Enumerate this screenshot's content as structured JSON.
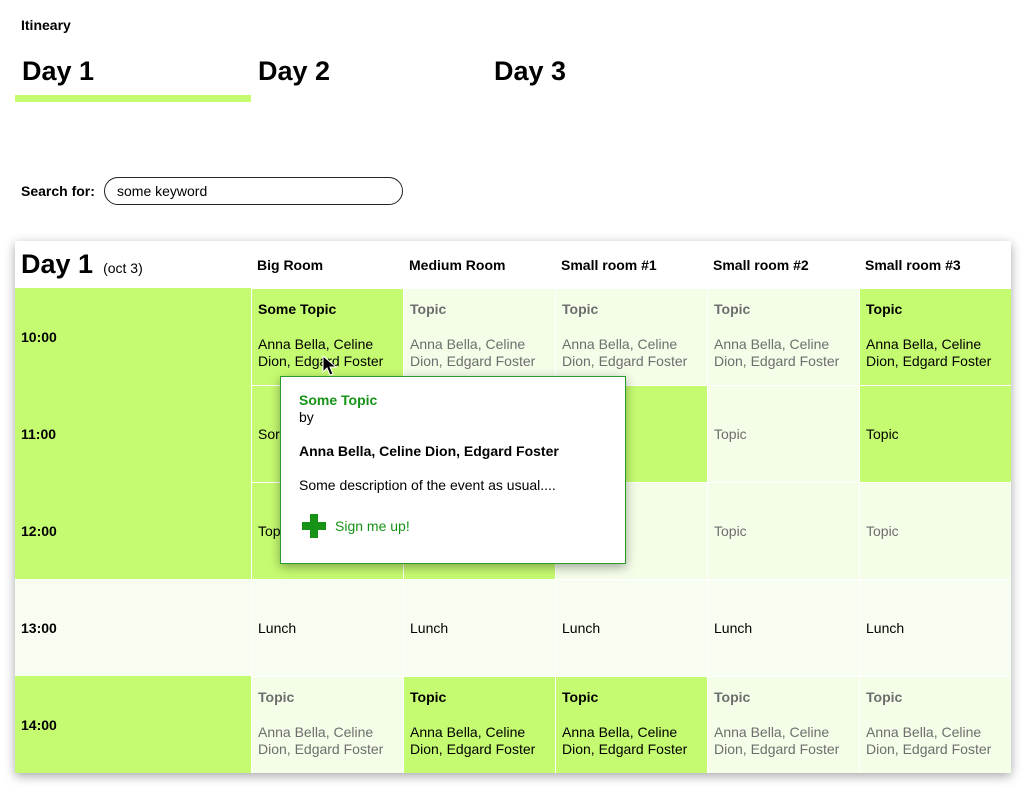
{
  "app": {
    "title": "Itineary"
  },
  "tabs": [
    {
      "label": "Day 1",
      "active": true
    },
    {
      "label": "Day 2",
      "active": false
    },
    {
      "label": "Day 3",
      "active": false
    }
  ],
  "search": {
    "label": "Search for:",
    "value": "some keyword"
  },
  "schedule": {
    "day_title": "Day 1",
    "day_date": "(oct 3)",
    "rooms": [
      "Big Room",
      "Medium Room",
      "Small room #1",
      "Small room #2",
      "Small room #3"
    ],
    "times": [
      "10:00",
      "11:00",
      "12:00",
      "13:00",
      "14:00"
    ],
    "sessions": {
      "r10": [
        {
          "title": "Some Topic",
          "speakers": "Anna Bella, Celine Dion, Edgard Foster"
        },
        {
          "title": "Topic",
          "speakers": "Anna Bella, Celine Dion, Edgard Foster"
        },
        {
          "title": "Topic",
          "speakers": "Anna Bella, Celine Dion, Edgard Foster"
        },
        {
          "title": "Topic",
          "speakers": "Anna Bella, Celine Dion, Edgard Foster"
        },
        {
          "title": "Topic",
          "speakers": "Anna Bella, Celine Dion, Edgard Foster"
        }
      ],
      "r11": [
        "Sor",
        "",
        "",
        "Topic",
        "Topic"
      ],
      "r12": [
        "Top",
        "",
        "",
        "Topic",
        "Topic"
      ],
      "r13": [
        "Lunch",
        "Lunch",
        "Lunch",
        "Lunch",
        "Lunch"
      ],
      "r14": [
        {
          "title": "Topic",
          "speakers": "Anna Bella, Celine Dion, Edgard Foster"
        },
        {
          "title": "Topic",
          "speakers": "Anna Bella, Celine Dion, Edgard Foster"
        },
        {
          "title": "Topic",
          "speakers": "Anna Bella, Celine Dion, Edgard Foster"
        },
        {
          "title": "Topic",
          "speakers": "Anna Bella, Celine Dion, Edgard Foster"
        },
        {
          "title": "Topic",
          "speakers": "Anna Bella, Celine Dion, Edgard Foster"
        }
      ]
    }
  },
  "popup": {
    "title": "Some Topic",
    "by": "by",
    "speakers": "Anna Bella, Celine Dion, Edgard Foster",
    "description": "Some description of the event as usual....",
    "signup_label": "Sign me up!"
  },
  "colors": {
    "accent": "#c5fb70",
    "light": "#f4fde8",
    "signup_green": "#169316"
  }
}
